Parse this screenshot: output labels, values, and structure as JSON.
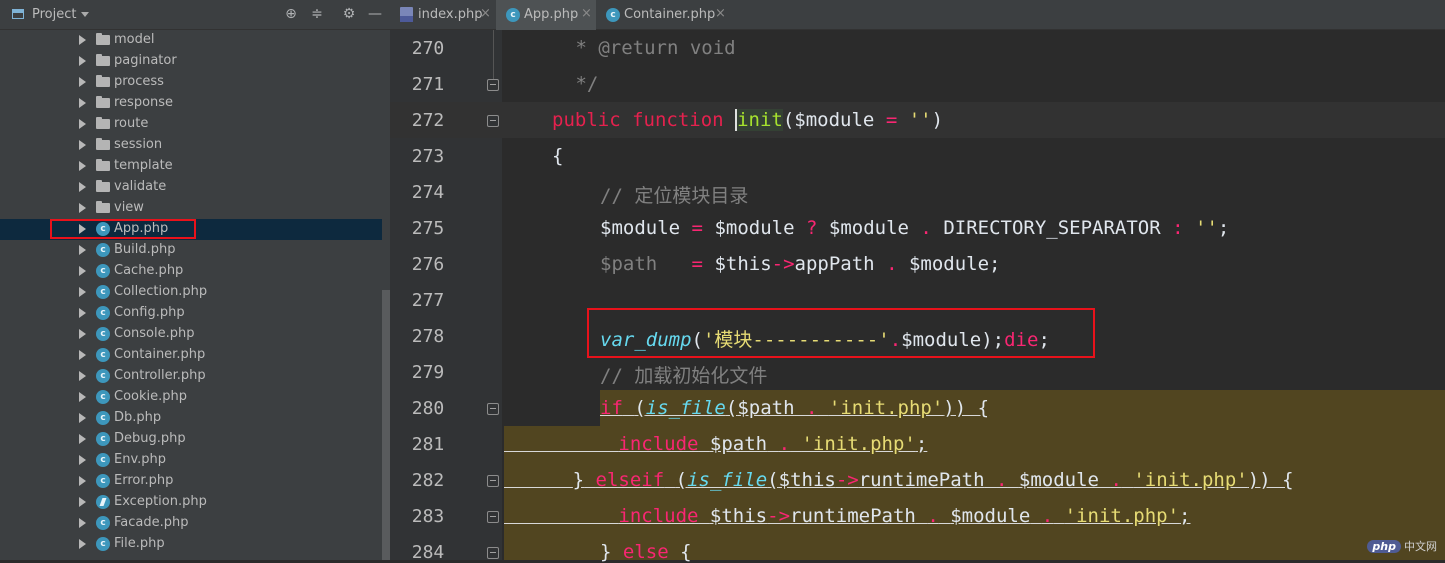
{
  "project": {
    "title": "Project",
    "tools": [
      "target-icon",
      "collapse-icon",
      "gear-icon",
      "minimize-icon"
    ]
  },
  "tree": {
    "items": [
      {
        "label": "model",
        "type": "folder"
      },
      {
        "label": "paginator",
        "type": "folder"
      },
      {
        "label": "process",
        "type": "folder"
      },
      {
        "label": "response",
        "type": "folder"
      },
      {
        "label": "route",
        "type": "folder"
      },
      {
        "label": "session",
        "type": "folder"
      },
      {
        "label": "template",
        "type": "folder"
      },
      {
        "label": "validate",
        "type": "folder"
      },
      {
        "label": "view",
        "type": "folder"
      },
      {
        "label": "App.php",
        "type": "class",
        "selected": true
      },
      {
        "label": "Build.php",
        "type": "class"
      },
      {
        "label": "Cache.php",
        "type": "class"
      },
      {
        "label": "Collection.php",
        "type": "class"
      },
      {
        "label": "Config.php",
        "type": "class"
      },
      {
        "label": "Console.php",
        "type": "class"
      },
      {
        "label": "Container.php",
        "type": "class"
      },
      {
        "label": "Controller.php",
        "type": "class"
      },
      {
        "label": "Cookie.php",
        "type": "class"
      },
      {
        "label": "Db.php",
        "type": "class"
      },
      {
        "label": "Debug.php",
        "type": "class"
      },
      {
        "label": "Env.php",
        "type": "class"
      },
      {
        "label": "Error.php",
        "type": "class"
      },
      {
        "label": "Exception.php",
        "type": "exception"
      },
      {
        "label": "Facade.php",
        "type": "class"
      },
      {
        "label": "File.php",
        "type": "class"
      }
    ]
  },
  "tabs": [
    {
      "label": "index.php",
      "icon": "php-file-icon",
      "active": false
    },
    {
      "label": "App.php",
      "icon": "class-icon",
      "active": true
    },
    {
      "label": "Container.php",
      "icon": "class-icon",
      "active": false
    }
  ],
  "tab_close": "×",
  "editor": {
    "lines": [
      "270",
      "271",
      "272",
      "273",
      "274",
      "275",
      "276",
      "277",
      "278",
      "279",
      "280",
      "281",
      "282",
      "283",
      "284"
    ]
  },
  "watermark": {
    "logo": "php",
    "text": "中文网"
  },
  "colors": {
    "highlight_box": "#e8121b",
    "selection": "#0d293e",
    "yellow_highlight": "#514520"
  }
}
